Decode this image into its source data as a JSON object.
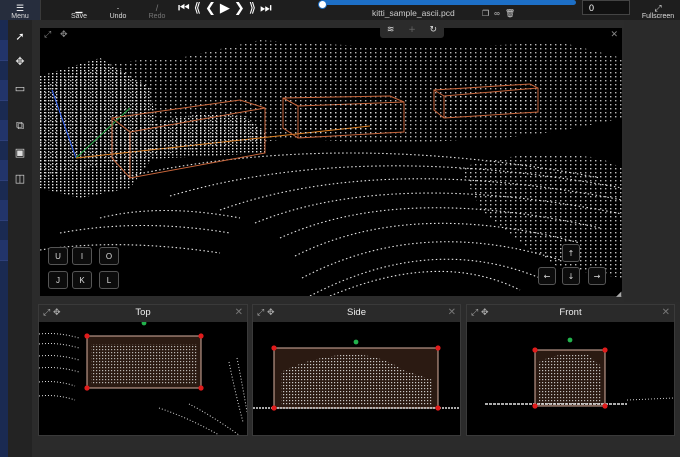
{
  "toolbar": {
    "menu_label": "Menu",
    "save_label": "Save",
    "undo_label": "Undo",
    "redo_label": "Redo",
    "fullscreen_label": "Fullscreen",
    "frame_value": "0"
  },
  "file": {
    "name": "kitti_sample_ascii.pcd"
  },
  "camera_buttons": [
    "U",
    "I",
    "O",
    "J",
    "K",
    "L"
  ],
  "subviews": {
    "top": "Top",
    "side": "Side",
    "front": "Front"
  },
  "colors": {
    "accent": "#1d6fc6",
    "box": "#d9702e",
    "handle": "#e01b1b",
    "rotate_handle": "#22b24c"
  }
}
